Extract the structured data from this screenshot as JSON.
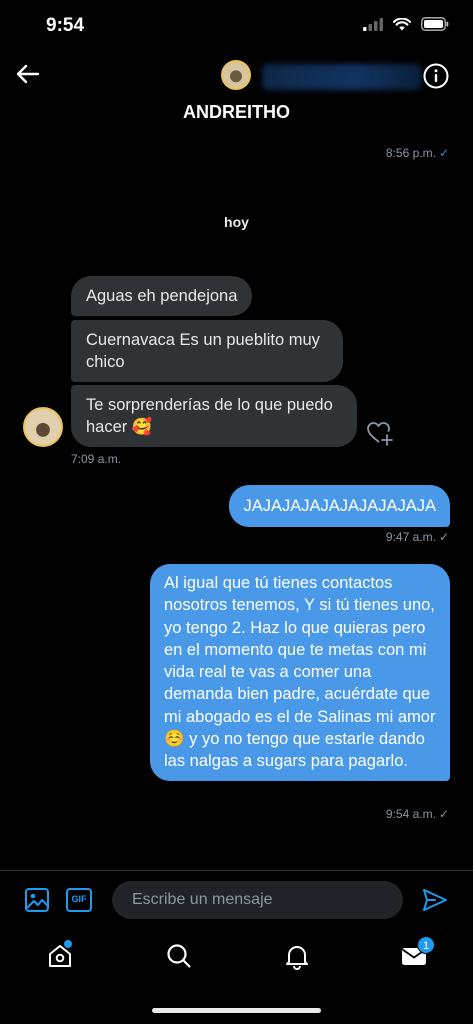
{
  "status": {
    "time": "9:54"
  },
  "header": {
    "name": "ANDREITHO"
  },
  "prev": {
    "time": "8:56 p.m.",
    "check": "✓"
  },
  "day_separator": "hoy",
  "incoming": {
    "messages": [
      "Aguas eh pendejona",
      "Cuernavaca Es un pueblito muy chico",
      "Te sorprenderías de lo que puedo hacer 🥰"
    ],
    "time": "7:09 a.m."
  },
  "outgoing": [
    {
      "text": "JAJAJAJAJAJAJAJAJAJA",
      "time": "9:47 a.m.",
      "check": "✓"
    },
    {
      "text": "Al igual que tú tienes contactos nosotros tenemos, Y si tú tienes uno, yo tengo 2. Haz lo que quieras pero en el momento que te metas con mi vida real te vas a comer una demanda bien padre, acuérdate que mi abogado es el de Salinas mi amor ☺️ y yo no tengo que estarle dando las nalgas a sugars para pagarlo.",
      "time": "9:54 a.m.",
      "check": "✓"
    }
  ],
  "composer": {
    "placeholder": "Escribe un mensaje",
    "gif_label": "GIF"
  },
  "tabs": {
    "messages_badge": "1"
  },
  "colors": {
    "accent": "#1d9bf0",
    "outgoing_bubble": "#4a99e9",
    "incoming_bubble": "#2f3336",
    "background": "#000000"
  }
}
